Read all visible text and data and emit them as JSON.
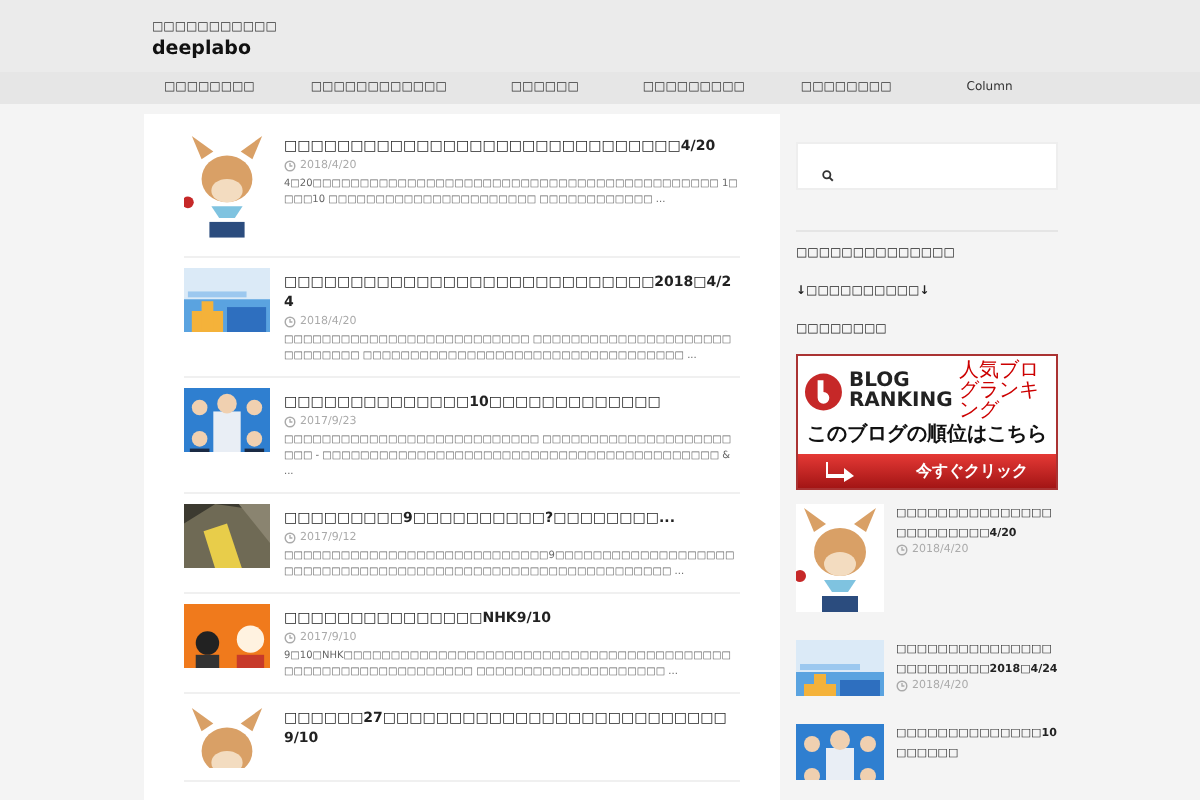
{
  "site": {
    "tagline": "□□□□□□□□□□□",
    "title": "deeplabo"
  },
  "nav": [
    "□□□□□□□□",
    "□□□□□□□□□□□□",
    "□□□□□□",
    "□□□□□□□□□",
    "□□□□□□□□",
    "Column"
  ],
  "posts": [
    {
      "title": "□□□□□□□□□□□□□□□□□□□□□□□□□□□□□□4/20",
      "date": "2018/4/20",
      "excerpt": "4□20□□□□□□□□□□□□□□□□□□□□□□□□□□□□□□□□□□□□□□□□□□□ 1□□□□10 □□□□□□□□□□□□□□□□□□□□□□ □□□□□□□□□□□□ ..."
    },
    {
      "title": "□□□□□□□□□□□□□□□□□□□□□□□□□□□□2018□4/24",
      "date": "2018/4/20",
      "excerpt": "□□□□□□□□□□□□□□□□□□□□□□□□□□ □□□□□□□□□□□□□□□□□□□□□□□□□□□□□ □□□□□□□□□□□□□□□□□□□□□□□□□□□□□□□□□□ ..."
    },
    {
      "title": "□□□□□□□□□□□□□□10□□□□□□□□□□□□□",
      "date": "2017/9/23",
      "excerpt": "□□□□□□□□□□□□□□□□□□□□□□□□□□□ □□□□□□□□□□□□□□□□□□□□□□□ - □□□□□□□□□□□□□□□□□□□□□□□□□□□□□□□□□□□□□□□□□□ & ..."
    },
    {
      "title": "□□□□□□□□□9□□□□□□□□□□?□□□□□□□□...",
      "date": "2017/9/12",
      "excerpt": "□□□□□□□□□□□□□□□□□□□□□□□□□□□□9□□□□□□□□□□□□□□□□□□□ □□□□□□□□□□□□□□□□□□□□□□□□□□□□□□□□□□□□□□□□□ ..."
    },
    {
      "title": "□□□□□□□□□□□□□□□NHK9/10",
      "date": "2017/9/10",
      "excerpt": "9□10□NHK□□□□□□□□□□□□□□□□□□□□□□□□□□□□□□□□□□□□□□□□□ □□□□□□□□□□□□□□□□□□□□ □□□□□□□□□□□□□□□□□□□□ ..."
    },
    {
      "title": "□□□□□□27□□□□□□□□□□□□□□□□□□□□□□□□□□9/10"
    }
  ],
  "sidebar": {
    "headings": [
      "□□□□□□□□□□□□□□",
      "↓□□□□□□□□□□↓",
      "□□□□□□□□"
    ],
    "banner": {
      "brand_top": "BLOG",
      "brand_bottom": "RANKING",
      "brand_sub": "人気ブログランキング",
      "headline": "このブログの順位はこちら",
      "cta": "今すぐクリック"
    },
    "recent_posts": [
      {
        "title": "□□□□□□□□□□□□□□□□□□□□□□□□4/20",
        "date": "2018/4/20"
      },
      {
        "title": "□□□□□□□□□□□□□□□□□□□□□□□□2018□4/24",
        "date": "2018/4/20"
      },
      {
        "title": "□□□□□□□□□□□□□□10□□□□□□"
      }
    ]
  }
}
